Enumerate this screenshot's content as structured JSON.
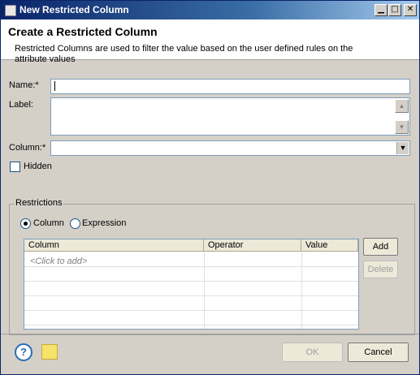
{
  "window": {
    "title": "New Restricted Column"
  },
  "header": {
    "title": "Create a Restricted Column",
    "description": "Restricted Columns are used to filter the value based on the user defined rules on the attribute values"
  },
  "form": {
    "name_label": "Name:*",
    "name_value": "",
    "label_label": "Label:",
    "label_value": "",
    "column_label": "Column:*",
    "column_value": "",
    "hidden_label": "Hidden",
    "hidden_checked": false
  },
  "restrictions": {
    "group_title": "Restrictions",
    "radio_column_label": "Column",
    "radio_expression_label": "Expression",
    "selected": "Column",
    "table": {
      "headers": [
        "Column",
        "Operator",
        "Value"
      ],
      "placeholder_row": "<Click to add>"
    },
    "add_label": "Add",
    "delete_label": "Delete"
  },
  "footer": {
    "ok_label": "OK",
    "cancel_label": "Cancel"
  },
  "icons": {
    "help": "help-icon",
    "note": "note-icon"
  },
  "colors": {
    "title_bar": "#0a246a",
    "dialog_bg": "#d4d0c8",
    "help_blue": "#2a6cb5",
    "note_yellow": "#f6e36a"
  }
}
